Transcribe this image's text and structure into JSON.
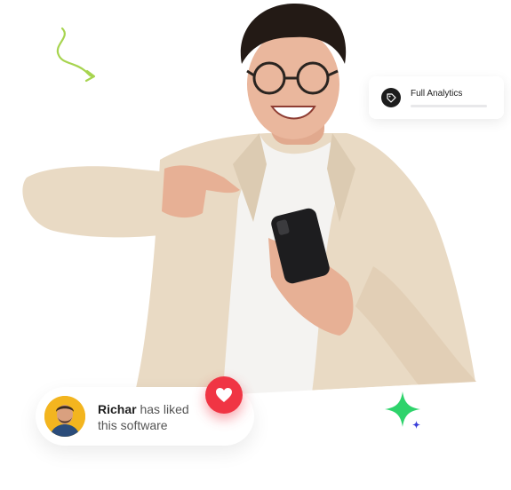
{
  "analytics_card": {
    "title": "Full Analytics",
    "icon": "tag-icon"
  },
  "like_notification": {
    "user_name": "Richar",
    "message_line1": " has liked",
    "message_line2": "this software",
    "icon": "heart-icon"
  },
  "colors": {
    "heart": "#f03544",
    "sparkle_large": "#2ed36b",
    "sparkle_small": "#3a3fd9",
    "arrow": "#a7d44f",
    "shirt": "#e8d8c2",
    "badge": "#1c1c1c"
  }
}
